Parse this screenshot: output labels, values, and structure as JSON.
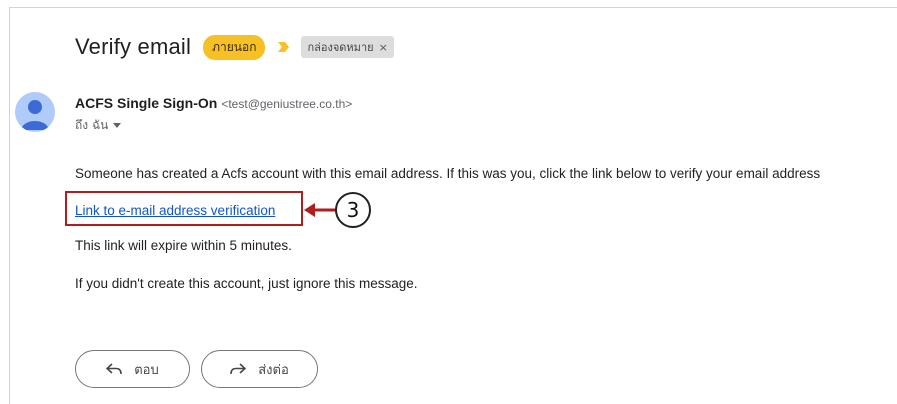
{
  "email": {
    "subject": "Verify email",
    "labels": {
      "external": "ภายนอก",
      "inbox": "กล่องจดหมาย",
      "inbox_remove": "×"
    },
    "sender_name": "ACFS Single Sign-On",
    "sender_email": "<test@geniustree.co.th>",
    "to_line": "ถึง ฉัน",
    "body": {
      "line1": "Someone has created a Acfs account with this email address. If this was you, click the link below to verify your email address",
      "link": "Link to e-mail address verification",
      "line3": "This link will expire within 5 minutes.",
      "line4": "If you didn't create this account, just ignore this message."
    },
    "actions": {
      "reply": "ตอบ",
      "forward": "ส่งต่อ"
    }
  },
  "annotation": {
    "step_number": "3",
    "color": "#b11c1c"
  },
  "colors": {
    "external_label": "#f6c026",
    "link": "#1155cc",
    "avatar": "#aecbfa"
  },
  "icons": [
    "importance-marker-icon",
    "person-avatar-icon",
    "reply-icon",
    "forward-icon",
    "dropdown-caret-icon"
  ]
}
